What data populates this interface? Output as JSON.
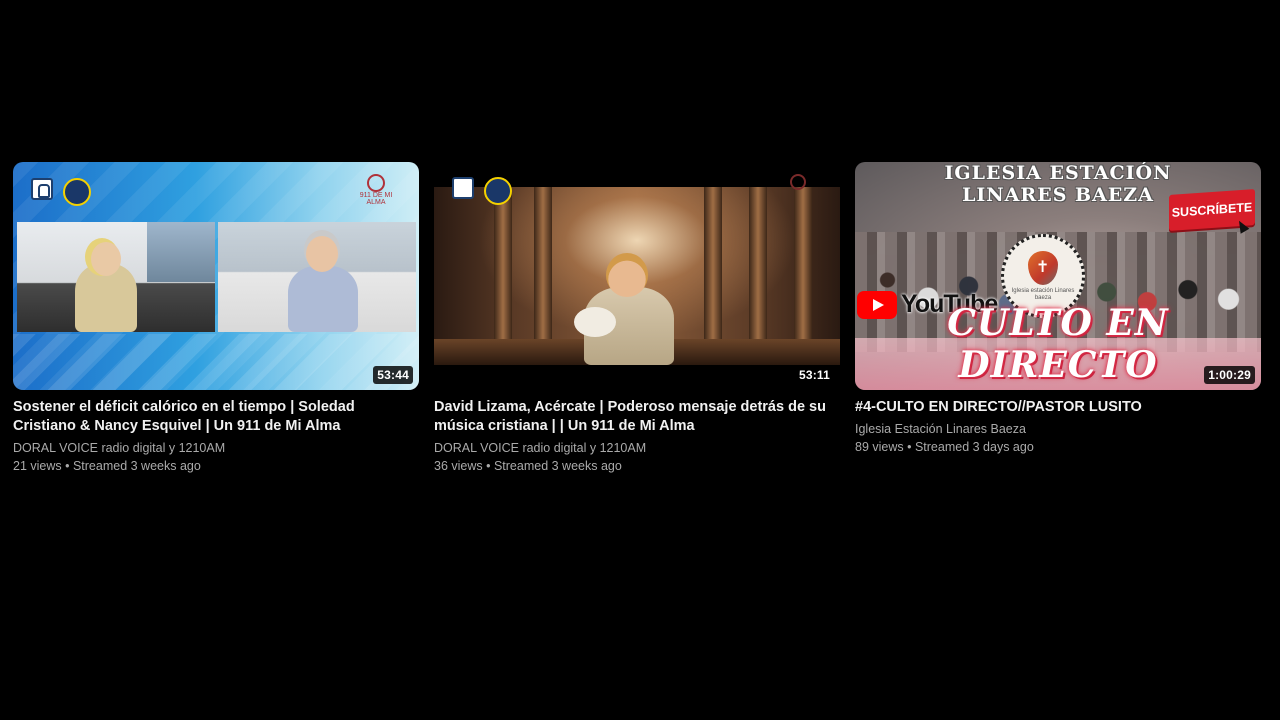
{
  "videos": [
    {
      "title": "Sostener el déficit calórico en el tiempo | Soledad Cristiano & Nancy Esquivel | Un 911 de Mi Alma",
      "channel": "DORAL VOICE radio digital y 1210AM",
      "meta": "21 views • Streamed 3 weeks ago",
      "duration": "53:44",
      "thumb_text": {
        "brand": "911 DE MI ALMA"
      }
    },
    {
      "title": "David Lizama, Acércate | Poderoso mensaje detrás de su música cristiana | | Un 911 de Mi Alma",
      "channel": "DORAL VOICE radio digital y 1210AM",
      "meta": "36 views • Streamed 3 weeks ago",
      "duration": "53:11"
    },
    {
      "title": "#4-CULTO EN DIRECTO//PASTOR LUSITO",
      "channel": "Iglesia Estación Linares Baeza",
      "meta": "89 views • Streamed 3 days ago",
      "duration": "1:00:29",
      "thumb_text": {
        "top_title_line1": "IGLESIA ESTACIÓN",
        "top_title_line2": "LINARES BAEZA",
        "subscribe": "SUSCRÍBETE",
        "logo_caption": "Iglesia estación Linares baeza",
        "youtube_word": "YouTube",
        "banner": "CULTO EN DIRECTO"
      }
    }
  ],
  "colors": {
    "background": "#000000",
    "title": "#f1f1f1",
    "secondary": "#aaaaaa",
    "youtube_red": "#ff0000"
  }
}
